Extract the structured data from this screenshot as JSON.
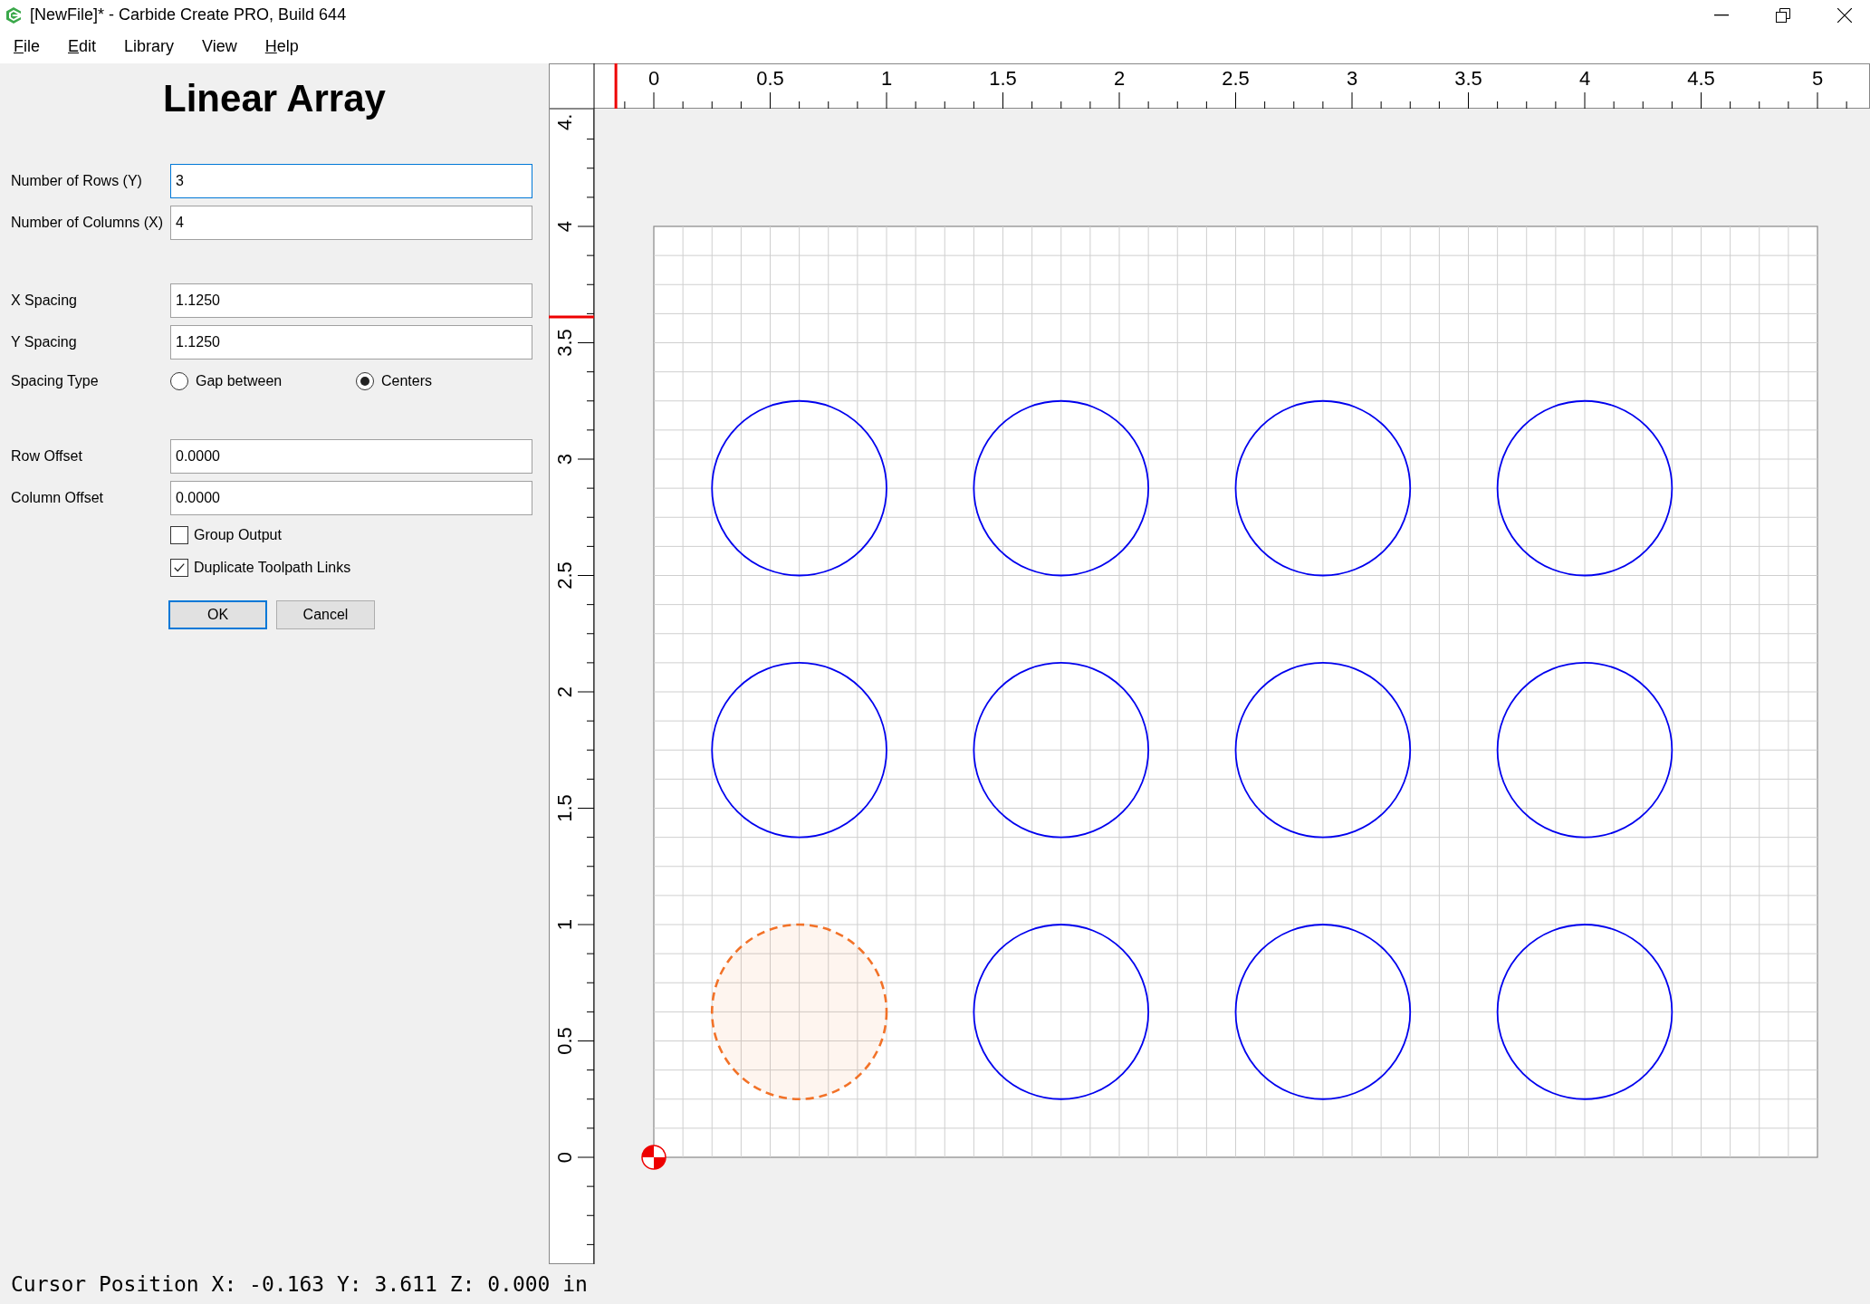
{
  "window": {
    "title": "[NewFile]* - Carbide Create PRO, Build 644"
  },
  "menu": [
    {
      "label": "File",
      "underlined": true
    },
    {
      "label": "Edit",
      "underlined": true
    },
    {
      "label": "Library",
      "underlined": false
    },
    {
      "label": "View",
      "underlined": false
    },
    {
      "label": "Help",
      "underlined": true
    }
  ],
  "dialog": {
    "title": "Linear Array",
    "groups": [
      {
        "items": [
          {
            "kind": "field",
            "label": "Number of Rows (Y)",
            "value": "3",
            "focused": true
          },
          {
            "kind": "field",
            "label": "Number of Columns (X)",
            "value": "4",
            "focused": false
          }
        ]
      },
      {
        "items": [
          {
            "kind": "field",
            "label": "X Spacing",
            "value": "1.1250",
            "focused": false
          },
          {
            "kind": "field",
            "label": "Y Spacing",
            "value": "1.1250",
            "focused": false
          },
          {
            "kind": "radio",
            "label": "Spacing Type",
            "options": [
              {
                "label": "Gap between",
                "selected": false
              },
              {
                "label": "Centers",
                "selected": true
              }
            ]
          }
        ]
      },
      {
        "items": [
          {
            "kind": "field",
            "label": "Row Offset",
            "value": "0.0000",
            "focused": false
          },
          {
            "kind": "field",
            "label": "Column Offset",
            "value": "0.0000",
            "focused": false
          },
          {
            "kind": "checkbox",
            "label": "Group Output",
            "checked": false
          },
          {
            "kind": "checkbox",
            "label": "Duplicate Toolpath Links",
            "checked": true
          }
        ]
      }
    ],
    "buttons": [
      {
        "label": "OK",
        "default": true
      },
      {
        "label": "Cancel",
        "default": false
      }
    ]
  },
  "canvas": {
    "top_ruler": [
      "0",
      "0.5",
      "1",
      "1.5",
      "2",
      "2.5",
      "3",
      "3.5",
      "4",
      "4.5",
      "5"
    ],
    "left_ruler": [
      "0",
      "0.5",
      "1",
      "1.5",
      "2",
      "2.5",
      "3",
      "3.5",
      "4",
      "4."
    ],
    "array": [
      [
        {
          "selected": false
        },
        {
          "selected": false
        },
        {
          "selected": false
        },
        {
          "selected": false
        }
      ],
      [
        {
          "selected": false
        },
        {
          "selected": false
        },
        {
          "selected": false
        },
        {
          "selected": false
        }
      ],
      [
        {
          "selected": true
        },
        {
          "selected": false
        },
        {
          "selected": false
        },
        {
          "selected": false
        }
      ]
    ]
  },
  "status_bar": "Cursor Position X: -0.163 Y: 3.611 Z: 0.000 in"
}
